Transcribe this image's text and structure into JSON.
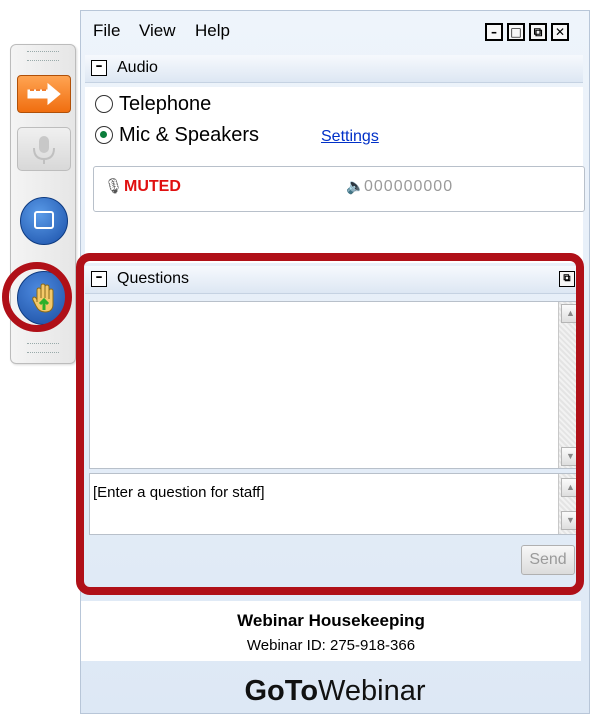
{
  "menu": {
    "file": "File",
    "view": "View",
    "help": "Help"
  },
  "window_buttons": {
    "minimize": "–",
    "restore": "□",
    "maximize": "⧉",
    "close": "✕"
  },
  "audio": {
    "title": "Audio",
    "collapse_symbol": "–",
    "options": [
      {
        "label": "Telephone",
        "selected": false
      },
      {
        "label": "Mic & Speakers",
        "selected": true
      }
    ],
    "settings_link": "Settings",
    "status": "MUTED",
    "level": "000000000",
    "speaker_glyph": "🔈",
    "mic_glyph": "🎙"
  },
  "questions": {
    "title": "Questions",
    "collapse_symbol": "–",
    "popout_symbol": "⧉",
    "input_placeholder": "[Enter a question for staff]",
    "send_label": "Send"
  },
  "info": {
    "title": "Webinar Housekeeping",
    "id_text": "Webinar ID: 275-918-366"
  },
  "brand": {
    "bold": "GoTo",
    "regular": "Webinar"
  },
  "colors": {
    "muted_text": "#e01010",
    "highlight_ring": "#b01018",
    "link": "#0030c8"
  },
  "icons": [
    "arrow-icon",
    "microphone-icon",
    "screen-icon",
    "raise-hand-icon"
  ]
}
